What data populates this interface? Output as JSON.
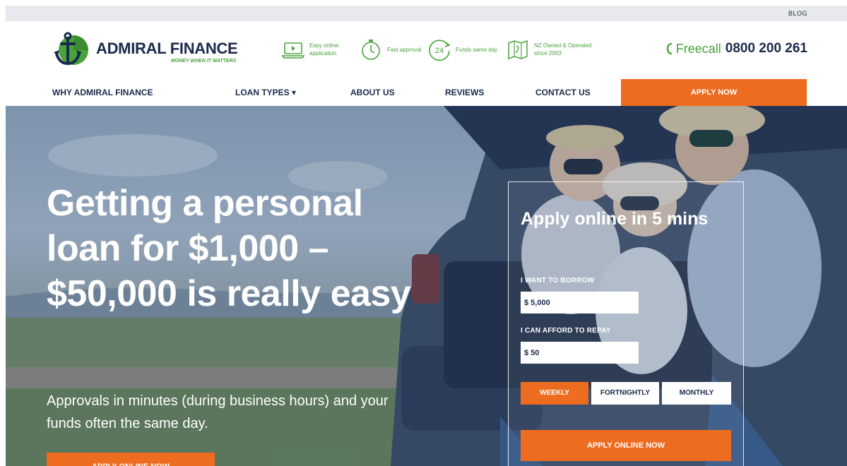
{
  "topbar": {
    "blog_label": "BLOG"
  },
  "brand": {
    "name": "ADMIRAL FINANCE",
    "tagline": "MONEY WHEN IT MATTERS",
    "icon": "anchor-logo-icon"
  },
  "features": [
    {
      "icon": "laptop-icon",
      "text": "Easy online application"
    },
    {
      "icon": "stopwatch-icon",
      "text": "Fast approval"
    },
    {
      "icon": "24-hours-icon",
      "text": "Funds same day"
    },
    {
      "icon": "nz-map-icon",
      "text": "NZ Owned & Operated since 2003"
    }
  ],
  "phone": {
    "icon": "phone-icon",
    "label": "Freecall",
    "number": "0800 200 261"
  },
  "nav": {
    "items": [
      {
        "label": "WHY ADMIRAL FINANCE"
      },
      {
        "label": "LOAN TYPES ▾"
      },
      {
        "label": "ABOUT US"
      },
      {
        "label": "REVIEWS"
      },
      {
        "label": "CONTACT US"
      }
    ],
    "apply_label": "APPLY NOW"
  },
  "hero": {
    "title": "Getting a personal loan for $1,000 – $50,000 is really easy",
    "subtitle": "Approvals in minutes (during business hours) and your funds often the same day.",
    "cta_label": "APPLY ONLINE NOW"
  },
  "calculator": {
    "title": "Apply online in 5 mins",
    "borrow_label": "I WANT TO BORROW",
    "borrow_value": "$ 5,000",
    "repay_label": "I CAN AFFORD TO REPAY",
    "repay_value": "$ 50",
    "frequencies": [
      "WEEKLY",
      "FORTNIGHTLY",
      "MONTHLY"
    ],
    "selected_frequency": "WEEKLY",
    "submit_label": "APPLY ONLINE NOW"
  },
  "colors": {
    "accent": "#ee6c1f",
    "brand_green": "#48a33a",
    "brand_navy": "#1a2a4a",
    "topbar": "#e7e9ec"
  }
}
